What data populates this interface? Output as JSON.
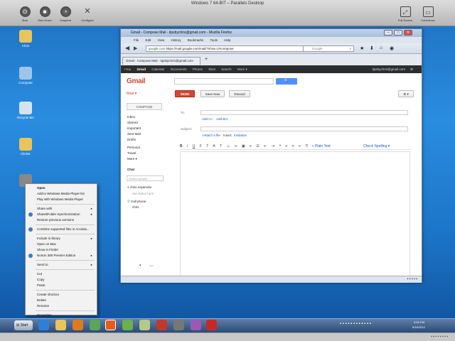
{
  "window_title": "Windows 7 64-BIT – Parallels Desktop",
  "parallels_toolbar": {
    "left": [
      "Start",
      "Shut Down",
      "Suspend",
      "Configure"
    ],
    "right": [
      "Full Screen",
      "Coherence"
    ]
  },
  "desktop_icons": [
    "Chris",
    "Computer",
    "Recycle Bin",
    "Clicker"
  ],
  "firefox": {
    "title": "Gmail - Compose Mail - tipsbychris@gmail.com - Mozilla Firefox",
    "tab_label": "Gmail - Compose Mail - tipsbychris@gmail.com",
    "menu": [
      "File",
      "Edit",
      "View",
      "History",
      "Bookmarks",
      "Tools",
      "Help"
    ],
    "url_domain": "google.com",
    "url": "https://mail.google.com/mail/?shva=1#compose",
    "search_placeholder": "Google"
  },
  "gmail": {
    "topbar": [
      "+You",
      "Gmail",
      "Calendar",
      "Documents",
      "Photos",
      "Sites",
      "Search",
      "More ▾"
    ],
    "account": "tipsbychris@gmail.com",
    "logo": "Gmail",
    "search_button": "🔍",
    "mail_label": "Mail ▾",
    "send": "SEND",
    "save_now": "Save Now",
    "discard": "Discard",
    "compose": "COMPOSE",
    "labels": [
      "Inbox",
      "Starred",
      "Important",
      "Sent Mail",
      "Drafts"
    ],
    "labels2": [
      "Personal",
      "Travel",
      "More ▾"
    ],
    "chat_heading": "Chat",
    "chat_search_placeholder": "Search people...",
    "chat_user": "chris miyamoto",
    "chat_status": "Set status here",
    "call_phone": "Call phone",
    "chat_contact": "chris",
    "to_label": "To:",
    "add_cc": "Add Cc",
    "add_bcc": "Add Bcc",
    "subject_label": "Subject:",
    "attach": "Attach a file",
    "insert": "Insert:",
    "invitation": "Invitation",
    "plain_text": "« Plain Text",
    "check_spelling": "Check Spelling ▾"
  },
  "context_menu": {
    "items": [
      {
        "label": "Open",
        "bold": true
      },
      {
        "label": "Add to Windows Media Player list"
      },
      {
        "label": "Play with Windows Media Player"
      },
      {
        "sep": true
      },
      {
        "label": "Share with",
        "arrow": true
      },
      {
        "label": "SharedFolder Synchronization",
        "arrow": true,
        "icon": true
      },
      {
        "label": "Restore previous versions"
      },
      {
        "sep": true
      },
      {
        "label": "Combine supported files in Acrobat...",
        "icon": true
      },
      {
        "sep": true
      },
      {
        "label": "Include in library",
        "arrow": true
      },
      {
        "label": "Open on Mac"
      },
      {
        "label": "Show in Finder"
      },
      {
        "label": "Norton 360 Premier Edition",
        "arrow": true,
        "icon": true
      },
      {
        "sep": true
      },
      {
        "label": "Send to",
        "arrow": true
      },
      {
        "sep": true
      },
      {
        "label": "Cut"
      },
      {
        "label": "Copy"
      },
      {
        "label": "Paste"
      },
      {
        "sep": true
      },
      {
        "label": "Create shortcut"
      },
      {
        "label": "Delete"
      },
      {
        "label": "Rename"
      },
      {
        "sep": true
      },
      {
        "label": "Properties"
      }
    ]
  },
  "taskbar": {
    "start": "Start",
    "time": "9:55 PM",
    "date": "6/18/2012"
  }
}
